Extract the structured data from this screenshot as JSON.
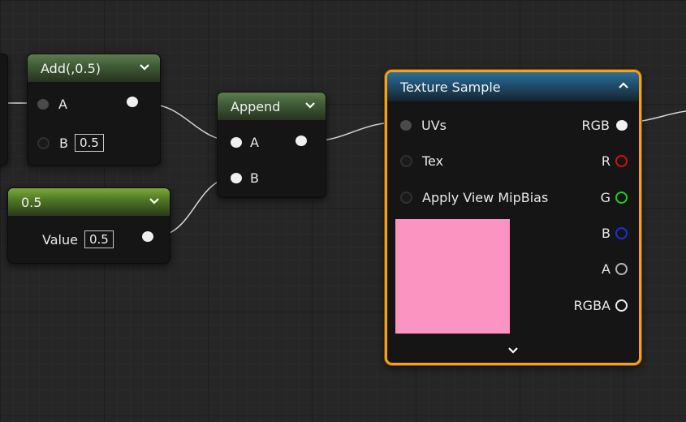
{
  "add_node": {
    "title": "Add(,0.5)",
    "pin_a": "A",
    "pin_b": "B",
    "b_value": "0.5"
  },
  "constant_node": {
    "title": "0.5",
    "value_label": "Value",
    "value": "0.5"
  },
  "append_node": {
    "title": "Append",
    "pin_a": "A",
    "pin_b": "B"
  },
  "texture_node": {
    "title": "Texture Sample",
    "inputs": [
      "UVs",
      "Tex",
      "Apply View MipBias"
    ],
    "outputs": [
      "RGB",
      "R",
      "G",
      "B",
      "A",
      "RGBA"
    ],
    "preview_color": "#fb94c1"
  },
  "colors": {
    "selection": "#f5a315",
    "r_pin": "#d11111",
    "g_pin": "#22cc22",
    "b_pin": "#1f2fd8",
    "a_pin": "#b5b5b5",
    "rgba_pin": "#eeeeee"
  }
}
